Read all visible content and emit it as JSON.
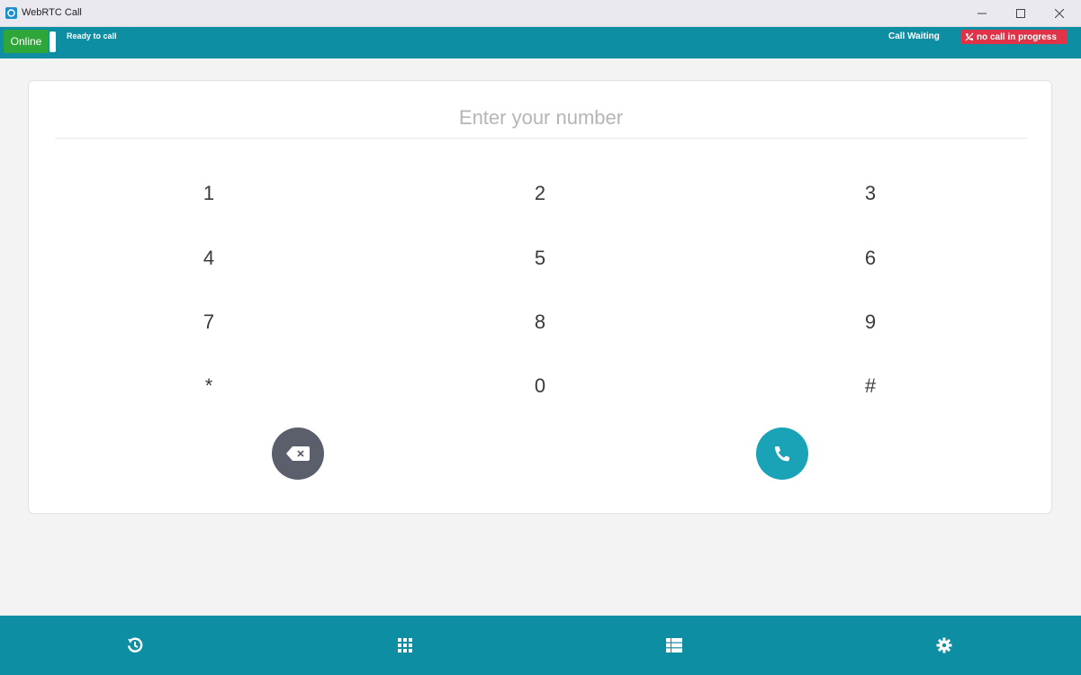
{
  "window": {
    "title": "WebRTC Call",
    "icon": "app-logo-icon",
    "controls": [
      "minimize-icon",
      "maximize-icon",
      "close-icon"
    ]
  },
  "status": {
    "online_label": "Online",
    "ready_text": "Ready to call",
    "call_waiting": "Call Waiting",
    "no_call_text": "no call in progress",
    "no_call_icon": "phone-off-icon"
  },
  "dialer": {
    "placeholder": "Enter your number",
    "value": "",
    "keys": [
      "1",
      "2",
      "3",
      "4",
      "5",
      "6",
      "7",
      "8",
      "9",
      "*",
      "0",
      "#"
    ],
    "backspace_icon": "backspace-icon",
    "call_icon": "phone-icon"
  },
  "nav": {
    "items": [
      "history-icon",
      "dialpad-icon",
      "contacts-icon",
      "settings-icon"
    ]
  },
  "colors": {
    "accent": "#0d8ea3",
    "online": "#2ea63a",
    "alert": "#e03348",
    "call_button": "#1aa3b6",
    "backspace_button": "#5b5f6b"
  }
}
